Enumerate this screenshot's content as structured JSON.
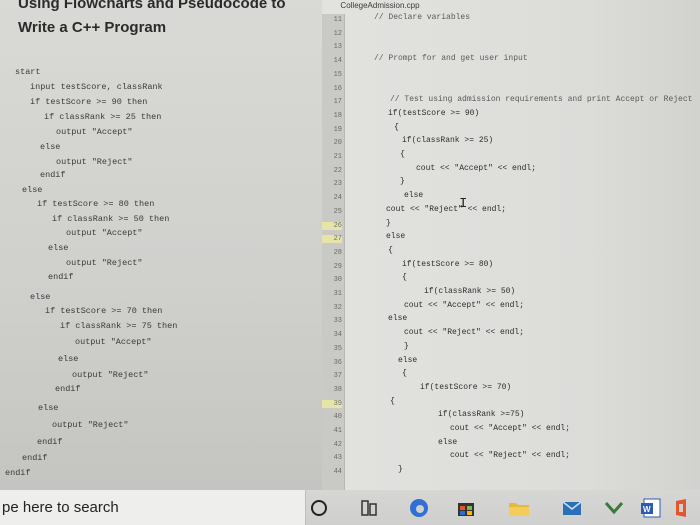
{
  "document": {
    "title_line1": "Using Flowcharts and Pseudocode to",
    "title_line2": "Write a C++ Program"
  },
  "pseudocode": [
    "start",
    "input testScore, classRank",
    "if testScore >= 90 then",
    "if classRank >= 25 then",
    "output \"Accept\"",
    "else",
    "output \"Reject\"",
    "endif",
    "else",
    "if testScore >= 80 then",
    "if classRank >= 50 then",
    "output \"Accept\"",
    "else",
    "output \"Reject\"",
    "endif",
    "else",
    "if testScore >= 70 then",
    "if classRank >= 75 then",
    "output \"Accept\"",
    "else",
    "output \"Reject\"",
    "endif",
    "else",
    "output \"Reject\"",
    "endif",
    "endif",
    "endif"
  ],
  "editor": {
    "tab_label": "CollegeAdmission.cpp",
    "line_numbers": [
      "11",
      "12",
      "13",
      "14",
      "15",
      "16",
      "17",
      "18",
      "19",
      "20",
      "21",
      "22",
      "23",
      "24",
      "25",
      "26",
      "27",
      "28",
      "29",
      "30",
      "31",
      "32",
      "33",
      "34",
      "35",
      "36",
      "37",
      "38",
      "39",
      "40",
      "41",
      "42",
      "43",
      "44"
    ],
    "code_lines": [
      "// Declare variables",
      "",
      "",
      "// Prompt for and get user input",
      "",
      "",
      "// Test using admission requirements and print Accept or Reject",
      "if(testScore >= 90)",
      "{",
      "if(classRank >= 25)",
      "{",
      "cout << \"Accept\" << endl;",
      "}",
      "else",
      "cout << \"Reject\" << endl;",
      "}",
      "else",
      "{",
      "if(testScore >= 80)",
      "{",
      "if(classRank >= 50)",
      "cout << \"Accept\" << endl;",
      "else",
      "cout << \"Reject\" << endl;",
      "}",
      "else",
      "{",
      "if(testScore >= 70)",
      "{",
      "if(classRank >=75)",
      "cout << \"Accept\" << endl;",
      "else",
      "cout << \"Reject\" << endl;",
      "}"
    ]
  },
  "taskbar": {
    "search_text": "pe here to search"
  },
  "colors": {
    "edge_blue": "#2f6fd6",
    "store_dark": "#333333",
    "folder_yellow": "#e8b83a",
    "mail_blue": "#2b6fb8",
    "check_green": "#3a7a3a",
    "word_blue": "#2b5ab8",
    "office_orange": "#e2572b"
  }
}
